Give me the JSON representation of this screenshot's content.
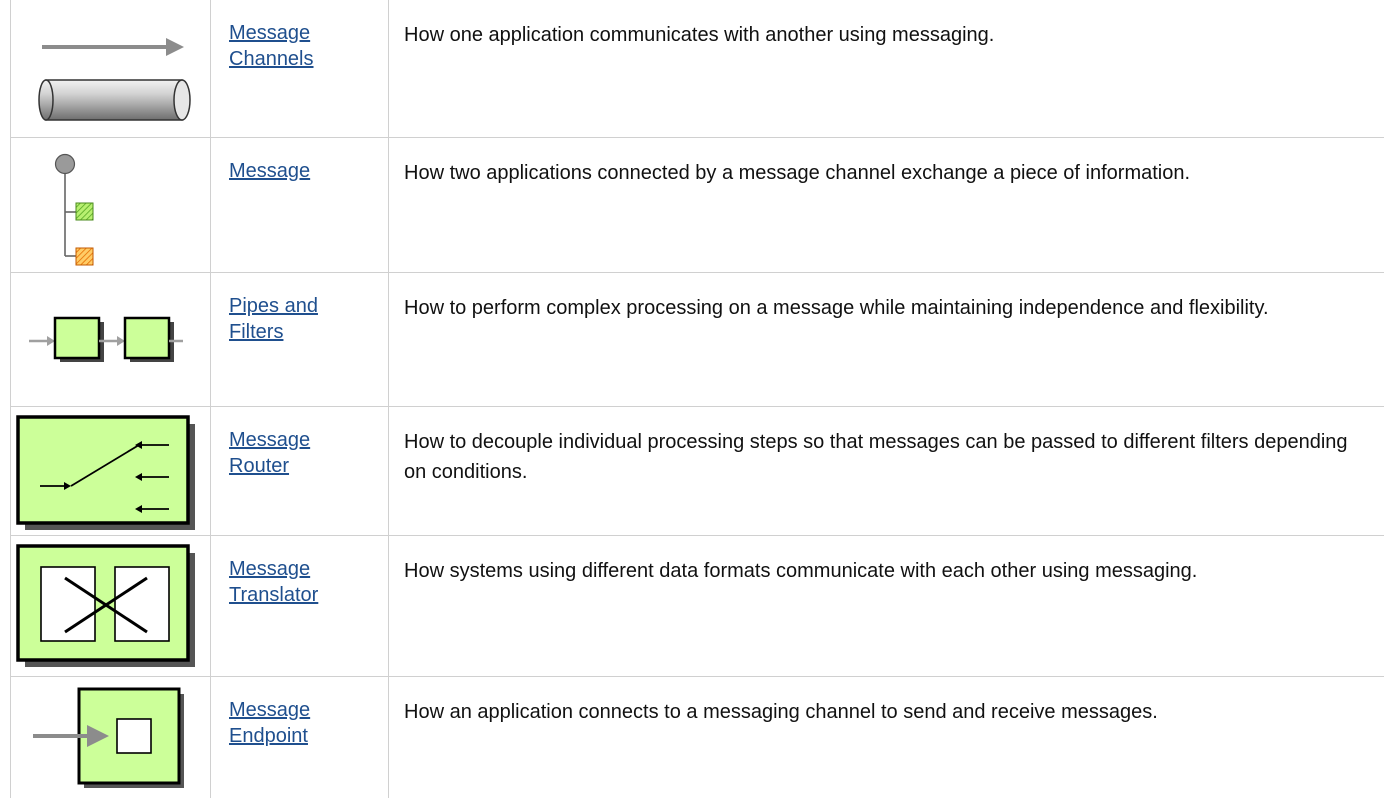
{
  "patterns": [
    {
      "name_lines": [
        "Message",
        "Channels"
      ],
      "description": "How one application communicates with another using messaging.",
      "icon": "message-channel-icon"
    },
    {
      "name_lines": [
        "Message"
      ],
      "description": "How two applications connected by a message channel exchange a piece of information.",
      "icon": "message-icon"
    },
    {
      "name_lines": [
        "Pipes and",
        "Filters"
      ],
      "description": "How to perform complex processing on a message while maintaining independence and flexibility.",
      "icon": "pipes-and-filters-icon"
    },
    {
      "name_lines": [
        "Message",
        "Router"
      ],
      "description": "How to decouple individual processing steps so that messages can be passed to different filters depending on conditions.",
      "icon": "message-router-icon"
    },
    {
      "name_lines": [
        "Message",
        "Translator"
      ],
      "description": "How systems using different data formats communicate with each other using messaging.",
      "icon": "message-translator-icon"
    },
    {
      "name_lines": [
        "Message",
        "Endpoint"
      ],
      "description": "How an application connects to a messaging channel to send and receive messages.",
      "icon": "message-endpoint-icon"
    }
  ],
  "colors": {
    "link": "#1f4f8e",
    "green_fill": "#ccff99",
    "border": "#d0d0d0",
    "orange": "#ff9933",
    "grey": "#999999"
  }
}
